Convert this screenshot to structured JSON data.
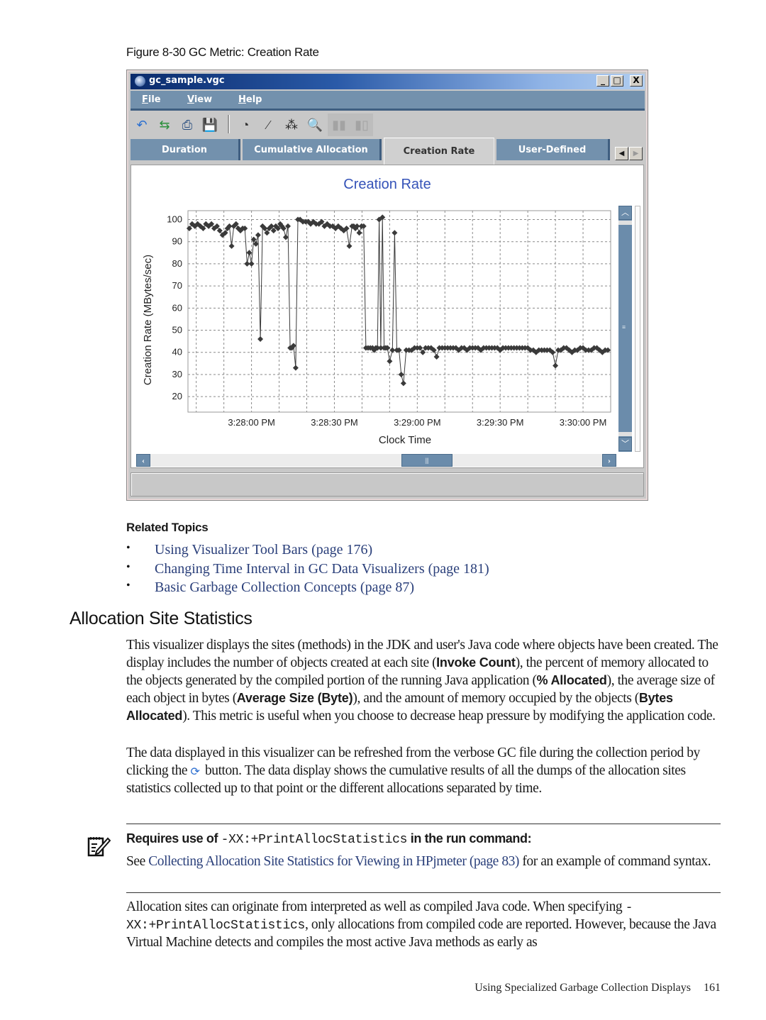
{
  "figure_caption": "Figure 8-30 GC Metric: Creation Rate",
  "window": {
    "title": "gc_sample.vgc",
    "controls": {
      "minimize": "_",
      "maximize": "□",
      "close": "X"
    },
    "menu": [
      {
        "label": "File",
        "mnemonic": "F",
        "rest": "ile"
      },
      {
        "label": "View",
        "mnemonic": "V",
        "rest": "iew"
      },
      {
        "label": "Help",
        "mnemonic": "H",
        "rest": "elp"
      }
    ],
    "toolbar": [
      {
        "name": "undo-icon",
        "glyph": "↶",
        "color": "#2a6fd0",
        "enabled": true
      },
      {
        "name": "refresh-data-icon",
        "glyph": "⇆",
        "color": "#2a8f3a",
        "enabled": true
      },
      {
        "name": "print-icon",
        "glyph": "⎙",
        "color": "#2a4f80",
        "enabled": true
      },
      {
        "name": "save-icon",
        "glyph": "💾",
        "color": "#2a4f80",
        "enabled": true
      },
      {
        "name": "time-interval-icon",
        "glyph": "◔",
        "color": "#333",
        "enabled": true
      },
      {
        "name": "line-plot-icon",
        "glyph": "⁄",
        "color": "#222",
        "enabled": true
      },
      {
        "name": "scatter-plot-icon",
        "glyph": "⁂",
        "color": "#222",
        "enabled": true
      },
      {
        "name": "zoom-out-icon",
        "glyph": "🔍",
        "color": "#2a6fd0",
        "enabled": true
      },
      {
        "name": "bar-chart-icon",
        "glyph": "▮▮",
        "color": "#999",
        "enabled": false
      },
      {
        "name": "stacked-bar-icon",
        "glyph": "▮▯",
        "color": "#999",
        "enabled": false
      }
    ],
    "tabs": [
      {
        "label": "Duration",
        "active": false
      },
      {
        "label": "Cumulative Allocation",
        "active": false
      },
      {
        "label": "Creation Rate",
        "active": true
      },
      {
        "label": "User-Defined",
        "active": false
      }
    ],
    "tab_scroll": {
      "left": "◀",
      "right": "▶"
    },
    "scroll": {
      "up": "︿",
      "down": "﹀",
      "left": "‹",
      "right": "›",
      "grip_v": "≡",
      "grip_h": "|||"
    }
  },
  "chart_data": {
    "type": "line",
    "title": "Creation Rate",
    "xlabel": "Clock Time",
    "ylabel": "Creation Rate  (MBytes/sec)",
    "x_unit": "seconds after 3:27:00 PM",
    "xlim": [
      37,
      190
    ],
    "ylim": [
      13,
      104
    ],
    "yticks": [
      20,
      30,
      40,
      50,
      60,
      70,
      80,
      90,
      100
    ],
    "ytick_labels": [
      "20",
      "30",
      "40",
      "50",
      "60",
      "70",
      "80",
      "90",
      "100"
    ],
    "xticks": [
      60,
      90,
      120,
      150,
      180
    ],
    "xtick_labels": [
      "3:28:00 PM",
      "3:28:30 PM",
      "3:29:00 PM",
      "3:29:30 PM",
      "3:30:00 PM"
    ],
    "grid": true,
    "marker": "diamond",
    "series": [
      {
        "name": "Creation Rate",
        "color": "#3a3a3a",
        "x": [
          37.5,
          38.5,
          39.5,
          40.5,
          41.5,
          42.5,
          43.5,
          44.5,
          45.5,
          46.5,
          47.5,
          48.5,
          49.5,
          50.5,
          51.3,
          52.0,
          52.8,
          53.6,
          54.4,
          55.2,
          56.0,
          56.8,
          57.6,
          58.4,
          59.2,
          60.0,
          60.8,
          61.6,
          62.4,
          63.2,
          64.0,
          64.8,
          65.6,
          66.4,
          67.2,
          68.0,
          68.8,
          69.6,
          70.4,
          71.0,
          71.6,
          72.4,
          73.2,
          74.0,
          74.6,
          75.2,
          76.0,
          76.8,
          77.6,
          78.6,
          79.6,
          80.6,
          81.4,
          82.4,
          83.4,
          84.4,
          85.4,
          86.4,
          87.4,
          88.4,
          89.4,
          90.4,
          91.4,
          92.4,
          93.4,
          94.4,
          95.4,
          96.4,
          97.0,
          97.6,
          98.2,
          99.0,
          99.8,
          100.6,
          101.4,
          102.2,
          103.0,
          103.8,
          104.4,
          105.0,
          105.6,
          106.2,
          106.8,
          107.4,
          108.0,
          108.6,
          109.2,
          110.0,
          111.0,
          111.8,
          112.6,
          113.4,
          114.2,
          115.0,
          116.0,
          117.0,
          118.0,
          119.0,
          120.0,
          121.0,
          122.0,
          123.0,
          124.0,
          125.0,
          126.0,
          127.0,
          128.0,
          129.0,
          130.0,
          131.0,
          132.0,
          133.0,
          134.0,
          135.0,
          136.0,
          137.0,
          138.0,
          139.0,
          140.0,
          141.0,
          142.0,
          143.0,
          144.0,
          145.0,
          146.0,
          147.0,
          148.0,
          149.0,
          150.0,
          151.0,
          152.0,
          153.0,
          154.0,
          155.0,
          156.0,
          157.0,
          158.0,
          159.0,
          160.0,
          161.0,
          162.0,
          163.0,
          164.0,
          165.0,
          166.0,
          167.0,
          168.0,
          169.0,
          170.0,
          171.0,
          172.0,
          173.0,
          174.0,
          175.0,
          176.0,
          177.0,
          178.0,
          179.0,
          180.0,
          181.0,
          182.0,
          183.0,
          184.0,
          185.0,
          186.0,
          187.0,
          188.0,
          189.0
        ],
        "y": [
          96,
          98,
          97,
          98,
          97,
          96,
          98,
          97,
          98,
          96,
          97,
          95,
          93,
          94,
          96,
          97,
          88,
          97,
          98,
          96,
          95,
          96,
          96,
          80,
          85,
          80,
          91,
          89,
          93,
          46,
          97,
          96,
          94,
          96,
          97,
          95,
          97,
          96,
          98,
          97,
          96,
          92,
          97,
          42,
          42,
          43,
          33,
          100,
          100,
          99,
          99,
          99,
          98,
          99,
          98,
          98,
          99,
          97,
          98,
          97,
          97,
          96,
          97,
          96,
          95,
          96,
          88,
          97,
          97,
          96,
          97,
          94,
          97,
          97,
          42,
          42,
          42,
          42,
          41,
          42,
          42,
          100,
          42,
          101,
          42,
          42,
          42,
          36,
          41,
          94,
          41,
          41,
          30,
          26,
          41,
          41,
          41,
          42,
          42,
          42,
          40,
          42,
          42,
          42,
          41,
          38,
          42,
          42,
          42,
          42,
          42,
          42,
          42,
          41,
          42,
          42,
          41,
          42,
          42,
          42,
          42,
          41,
          42,
          42,
          42,
          42,
          42,
          42,
          41,
          42,
          42,
          42,
          42,
          42,
          42,
          42,
          42,
          42,
          42,
          41,
          41,
          40,
          41,
          41,
          41,
          41,
          41,
          40,
          34,
          41,
          41,
          42,
          42,
          41,
          40,
          41,
          41,
          42,
          42,
          41,
          41,
          41,
          42,
          42,
          41,
          40,
          41,
          41,
          41,
          41,
          40
        ]
      }
    ]
  },
  "related_topics": {
    "heading": "Related Topics",
    "bullet": "•",
    "links": [
      "Using Visualizer Tool Bars (page 176)",
      "Changing Time Interval in GC Data Visualizers (page 181)",
      "Basic Garbage Collection Concepts (page 87)"
    ]
  },
  "section": {
    "title": "Allocation Site Statistics",
    "p1": {
      "t1": "This visualizer displays the sites (methods) in the JDK and user's Java code where objects have been created. The display includes the number of objects created at each site (",
      "b1": "Invoke Count",
      "t2": "), the percent of memory allocated to the objects generated by the compiled portion of the running Java application (",
      "b2": "% Allocated",
      "t3": "), the average size of each object in bytes (",
      "b3": "Average Size (Byte)",
      "t4": "), and the amount of memory occupied by the objects (",
      "b4": "Bytes Allocated",
      "t5": "). This metric is useful when you choose to decrease heap pressure by modifying the application code."
    },
    "p2": {
      "t1": "The data displayed in this visualizer can be refreshed from the verbose GC file during the collection period by clicking the ",
      "icon": "⟳",
      "t2": " button. The data display shows the cumulative results of all the dumps of the allocation sites statistics collected up to that point or the different allocations separated by time."
    },
    "note": {
      "head_before": "Requires use of ",
      "head_code": "-XX:+PrintAllocStatistics",
      "head_after": " in the run command:",
      "body_before": "See ",
      "body_link": "Collecting Allocation Site Statistics for Viewing in HPjmeter (page 83)",
      "body_after": " for an example of command syntax."
    },
    "p3": {
      "t1": "Allocation sites can originate from interpreted as well as compiled Java code. When specifying ",
      "code": "-XX:+PrintAllocStatistics",
      "t2": ", only allocations from compiled code are reported. However, because the Java Virtual Machine detects and compiles the most active Java methods as early as"
    }
  },
  "footer": {
    "text": "Using Specialized Garbage Collection Displays",
    "page": "161"
  }
}
